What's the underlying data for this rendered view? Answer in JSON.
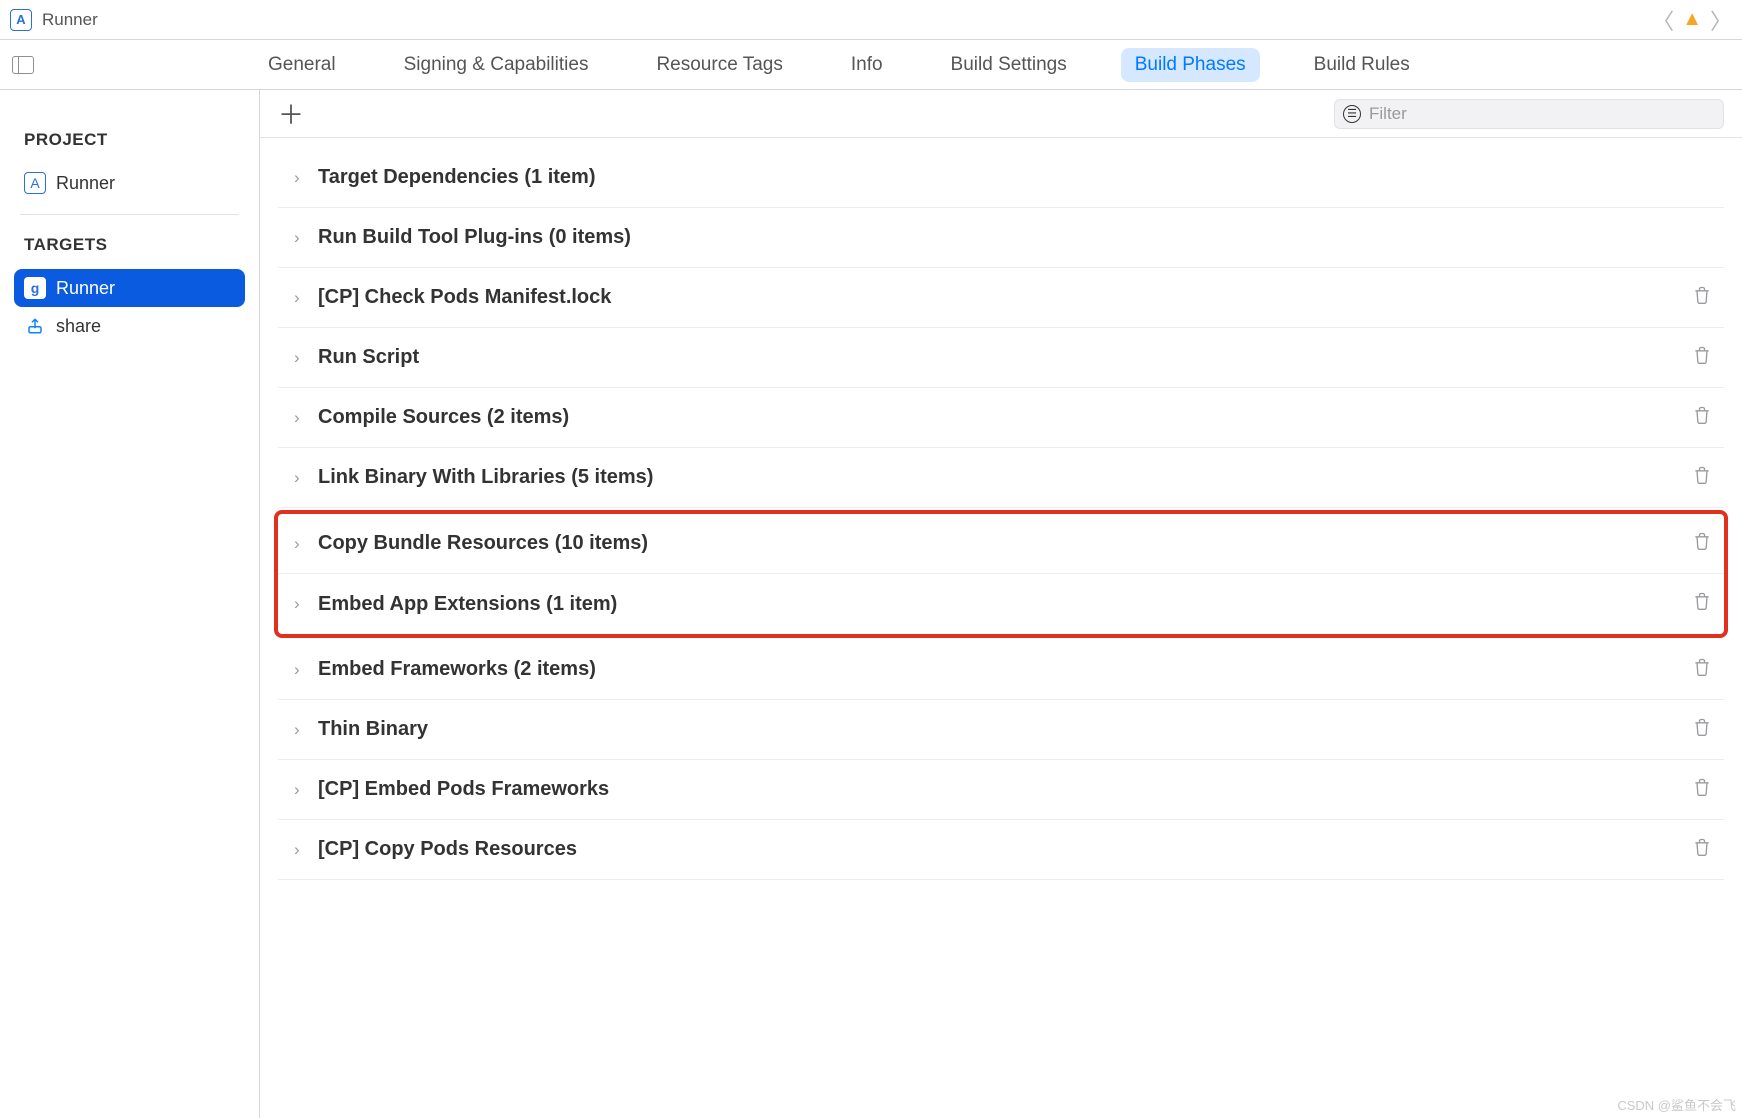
{
  "titlebar": {
    "title": "Runner"
  },
  "tabs": {
    "general": "General",
    "signing": "Signing & Capabilities",
    "resource": "Resource Tags",
    "info": "Info",
    "build_settings": "Build Settings",
    "build_phases": "Build Phases",
    "build_rules": "Build Rules",
    "active": "build_phases"
  },
  "sidebar": {
    "project_label": "PROJECT",
    "targets_label": "TARGETS",
    "project_name": "Runner",
    "targets": [
      {
        "name": "Runner",
        "icon": "g",
        "selected": true
      },
      {
        "name": "share",
        "icon": "share",
        "selected": false
      }
    ]
  },
  "toolbar": {
    "filter_placeholder": "Filter"
  },
  "phases": [
    {
      "title": "Target Dependencies (1 item)",
      "deletable": false,
      "highlight": false
    },
    {
      "title": "Run Build Tool Plug-ins (0 items)",
      "deletable": false,
      "highlight": false
    },
    {
      "title": "[CP] Check Pods Manifest.lock",
      "deletable": true,
      "highlight": false
    },
    {
      "title": "Run Script",
      "deletable": true,
      "highlight": false
    },
    {
      "title": "Compile Sources (2 items)",
      "deletable": true,
      "highlight": false
    },
    {
      "title": "Link Binary With Libraries (5 items)",
      "deletable": true,
      "highlight": false
    },
    {
      "title": "Copy Bundle Resources (10 items)",
      "deletable": true,
      "highlight": true
    },
    {
      "title": "Embed App Extensions (1 item)",
      "deletable": true,
      "highlight": true
    },
    {
      "title": "Embed Frameworks (2 items)",
      "deletable": true,
      "highlight": false
    },
    {
      "title": "Thin Binary",
      "deletable": true,
      "highlight": false
    },
    {
      "title": "[CP] Embed Pods Frameworks",
      "deletable": true,
      "highlight": false
    },
    {
      "title": "[CP] Copy Pods Resources",
      "deletable": true,
      "highlight": false
    }
  ],
  "watermark": "CSDN @鲨鱼不会飞"
}
